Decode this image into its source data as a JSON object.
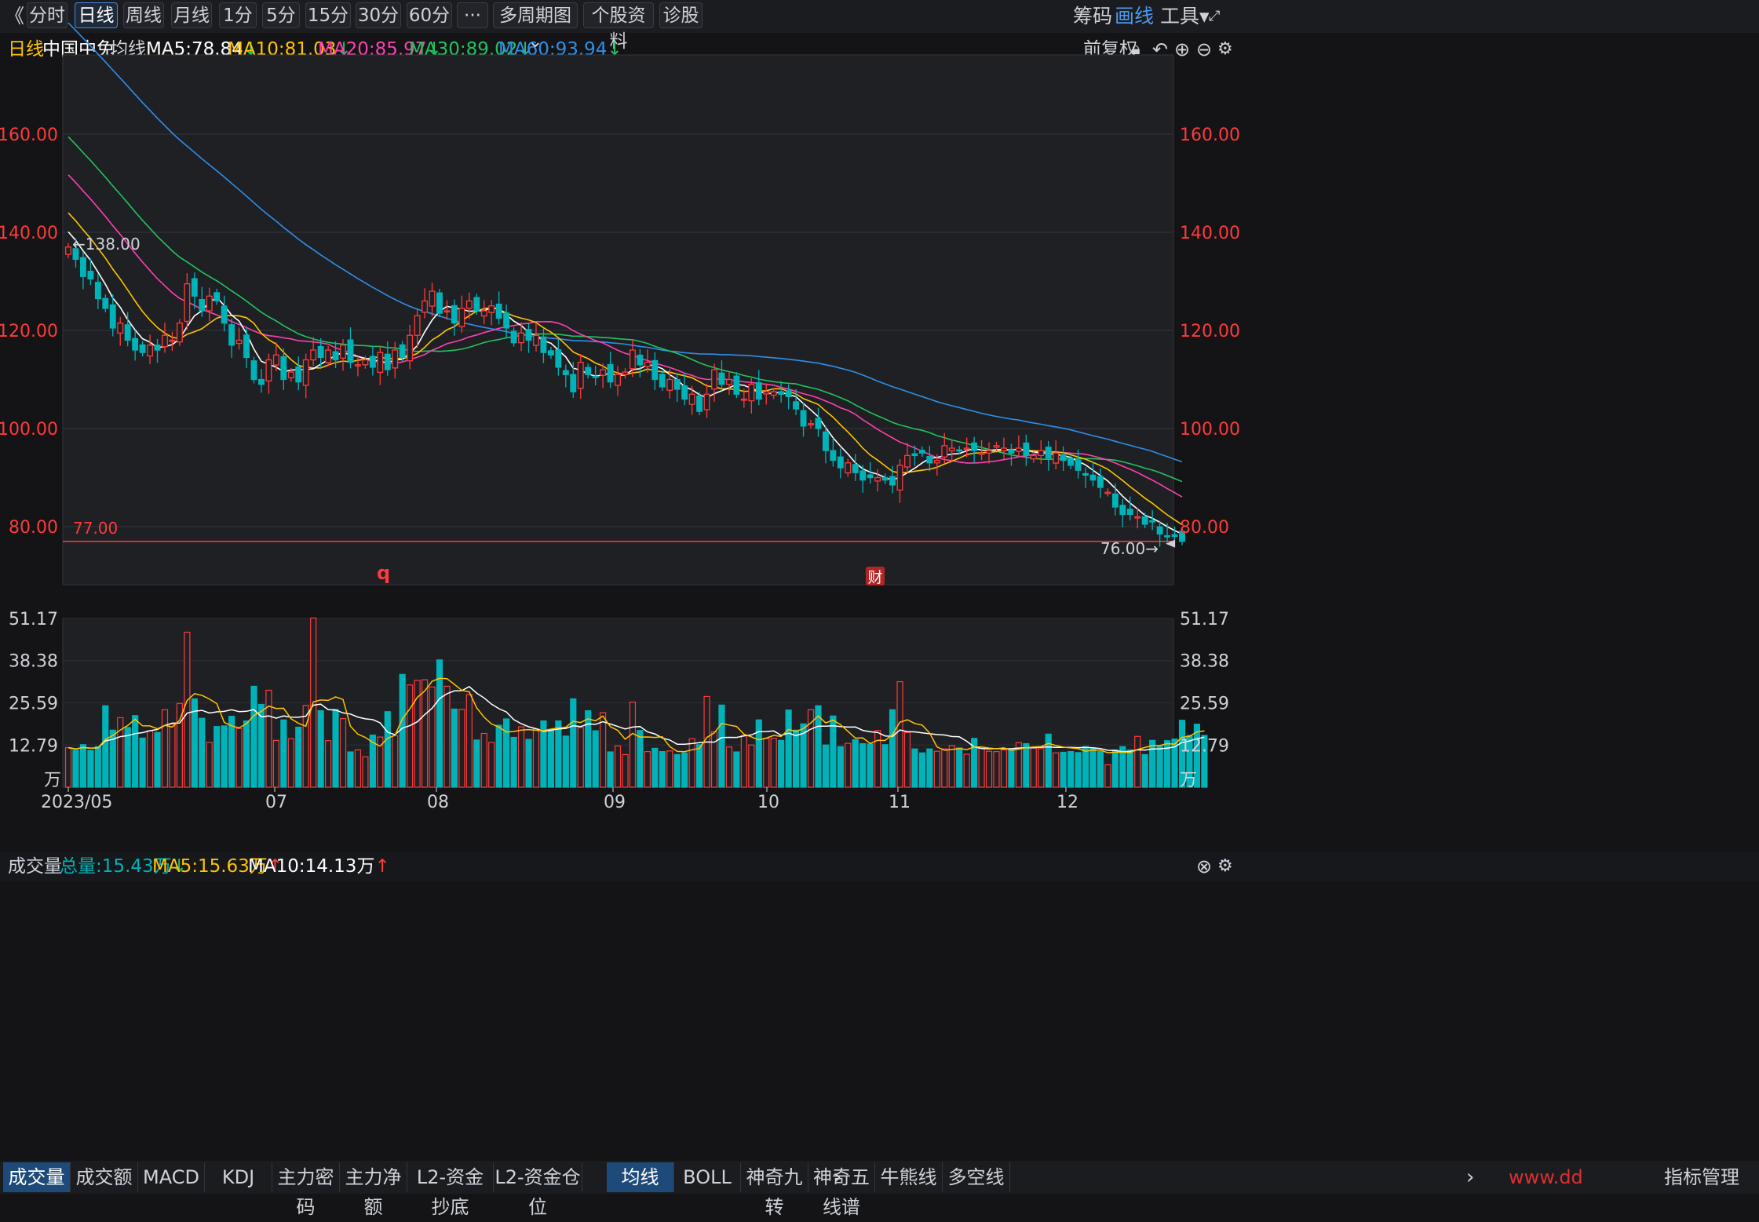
{
  "toolbar": {
    "back_icon": "chevron-double-left-icon",
    "periods": [
      "分时",
      "日线",
      "周线",
      "月线",
      "1分",
      "5分",
      "15分",
      "30分",
      "60分",
      "···",
      "多周期图 ⌄",
      "个股资料",
      "诊股"
    ],
    "active_period": "日线",
    "right": [
      "筹码",
      "画线",
      "工具▾"
    ]
  },
  "ma_bar": {
    "period": "日线",
    "stock": "中国中免",
    "label": "均线",
    "ma5": "MA5:78.84",
    "ma10": "MA10:81.03",
    "ma20": "MA20:85.97",
    "ma30": "MA30:89.02",
    "ma60": "MA60:93.94",
    "arrow_down": "↓",
    "adjust": "前复权"
  },
  "volume_bar": {
    "label": "成交量",
    "total": "总量:15.43万",
    "ma5": "MA5:15.63万",
    "ma10": "MA10:14.13万",
    "arrow_down": "↓",
    "arrow_up": "↑"
  },
  "bottom_tabs_left": [
    "成交量",
    "成交额",
    "MACD",
    "KDJ",
    "主力密码",
    "主力净额",
    "L2-资金抄底",
    "L2-资金仓位"
  ],
  "bottom_tabs_right": [
    "均线",
    "BOLL",
    "神奇九转",
    "神奇五线谱",
    "牛熊线",
    "多空线"
  ],
  "bottom_right": "指标管理",
  "watermark": "www.dd",
  "colors": {
    "up": "#ff3a3a",
    "down": "#00b3b8",
    "ma5": "#ffffff",
    "ma10": "#ffc400",
    "ma20": "#ff3fb0",
    "ma30": "#22c35e",
    "ma60": "#2e8fe8",
    "accent": "#4a86d6"
  },
  "chart_data": [
    {
      "type": "candlestick",
      "stock": "中国中免",
      "period": "日线",
      "y_ticks": [
        "160.00",
        "140.00",
        "120.00",
        "100.00",
        "80.00"
      ],
      "ylim": [
        72,
        177
      ],
      "x_ticks": [
        "2023/05",
        "07",
        "08",
        "09",
        "10",
        "11",
        "12"
      ],
      "annotations": {
        "high_label": "138.00",
        "low_label": "76.00→",
        "line_label": "77.00",
        "line_value": 77.0,
        "marker_q": "q",
        "marker_cai": "财"
      },
      "closes": [
        137,
        134.5,
        131,
        130.5,
        126.5,
        124.5,
        120.5,
        121.5,
        118,
        116,
        115.5,
        117,
        116,
        119,
        118,
        121.5,
        129.5,
        127,
        124,
        127,
        126,
        121.5,
        117,
        118,
        114.5,
        110,
        109,
        114,
        115,
        110,
        111.5,
        109.5,
        114,
        116,
        114.5,
        116,
        114,
        117,
        113.5,
        113,
        114,
        112.5,
        115.5,
        112,
        116,
        114.5,
        119,
        123,
        126,
        128,
        123.5,
        124,
        121.5,
        124.5,
        126,
        124,
        124,
        125,
        122.5,
        120.5,
        117.5,
        119.5,
        118,
        119,
        115.5,
        115,
        112.5,
        111,
        107.5,
        113.5,
        111,
        110.5,
        112,
        109.5,
        111,
        111.5,
        116,
        113,
        113.5,
        110,
        108.5,
        110,
        108,
        106,
        107,
        103.5,
        107,
        112,
        109,
        110,
        107,
        106,
        109,
        106,
        107.5,
        107.5,
        107,
        106.5,
        104,
        100.5,
        101,
        100,
        95.5,
        93.5,
        92,
        93,
        91,
        89.5,
        90,
        90,
        89.5,
        88.5,
        92.5,
        94.5,
        94.5,
        95,
        93,
        93.5,
        96.5,
        96,
        95.5,
        96,
        95.5,
        95,
        95.5,
        96.5,
        96,
        95,
        96,
        94.5,
        94.5,
        95.5,
        94,
        95,
        93.5,
        92.5,
        91.5,
        90.5,
        89.5,
        88,
        87,
        84,
        82.5,
        82.5,
        82,
        80.5,
        81,
        78.5,
        78,
        78,
        77
      ],
      "ma_series_names": [
        "MA5",
        "MA10",
        "MA20",
        "MA30",
        "MA60"
      ]
    },
    {
      "type": "bar",
      "title": "成交量",
      "unit": "万",
      "y_ticks": [
        "51.17",
        "38.38",
        "25.59",
        "12.79"
      ],
      "ylim": [
        0,
        51.17
      ],
      "values": [
        12,
        11.2,
        12.9,
        11.2,
        12.3,
        24.7,
        17.3,
        21.1,
        18.1,
        21.7,
        14.9,
        17.1,
        16.6,
        23.5,
        19.1,
        25.4,
        47,
        26.8,
        20.9,
        13.6,
        18.4,
        18.6,
        21.5,
        17.8,
        20.1,
        30.6,
        25.1,
        29.4,
        14.2,
        20.4,
        14.7,
        18.2,
        24.8,
        51.3,
        23.2,
        14.1,
        23.6,
        20.8,
        10.7,
        11.3,
        9.2,
        15.8,
        15.2,
        22.9,
        15.6,
        34.2,
        31,
        32.4,
        32.6,
        30.4,
        38.6,
        30.6,
        23.7,
        23.6,
        28.1,
        14.3,
        16.3,
        13.6,
        18.8,
        20.7,
        15.1,
        18.3,
        14.5,
        17.7,
        20.1,
        17.5,
        20.1,
        15.5,
        26.8,
        18.1,
        23.2,
        17.1,
        22.6,
        10.7,
        12.5,
        9.9,
        25.8,
        17.2,
        10.8,
        11.8,
        10.8,
        11,
        9.9,
        10.4,
        14.7,
        12.9,
        27.5,
        16.8,
        24.9,
        12.2,
        10.7,
        15.7,
        12.8,
        20.4,
        14.8,
        14.8,
        14.2,
        23.4,
        17.3,
        19.2,
        23.5,
        24.7,
        12.8,
        21.6,
        12.3,
        13.3,
        14.4,
        13.2,
        13.1,
        17.2,
        12.9,
        23.5,
        32,
        16.6,
        11.6,
        10.4,
        11.6,
        10.9,
        11.6,
        12.6,
        11.9,
        10,
        14.8,
        11.8,
        10.9,
        10.8,
        11.3,
        11.2,
        13.5,
        13.2,
        11.9,
        11.7,
        16.1,
        10.4,
        10.6,
        10.8,
        10.5,
        12.3,
        11.9,
        10.8,
        6.8,
        11.3,
        12.3,
        11.3,
        15.4,
        9.9,
        14.2,
        12.4,
        14.1,
        14.6,
        20.3,
        15.7,
        19.1,
        15.7
      ]
    }
  ]
}
